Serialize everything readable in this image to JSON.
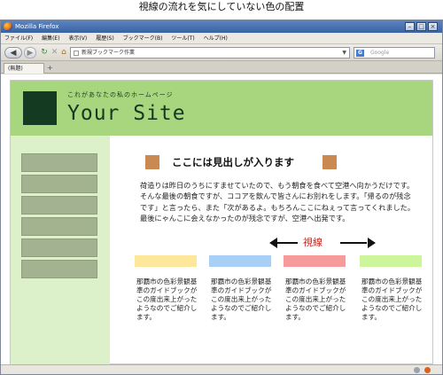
{
  "caption": "視線の流れを気にしていない色の配置",
  "browser": {
    "window_title": "Mozilla Firefox",
    "menu": [
      "ファイル(F)",
      "編集(E)",
      "表示(V)",
      "履歴(S)",
      "ブックマーク(B)",
      "ツール(T)",
      "ヘルプ(H)"
    ],
    "url": "新規ブックマーク作業",
    "search_placeholder": "Google",
    "tab_label": "(無題)",
    "new_tab": "+"
  },
  "site": {
    "tagline": "これがあなたの私のホームページ",
    "title": "Your Site",
    "heading": "ここには見出しが入ります",
    "paragraph": "荷造りは昨日のうちにすませていたので、もう朝食を食べて空港へ向かうだけです。そんな最後の朝食ですが、ココアを飲んで皆さんにお別れをします。「帰るのが残念です」と言ったら、また「次があるよ。もちろんここにねぇって言ってくれました。最後にゃんこに会えなかったのが残念ですが、空港へ出発です。",
    "arrow_label": "視線",
    "sidebar_count": 6,
    "columns": [
      {
        "color": "#fde79a",
        "text": "那覇市の色彩景観基準のガイドブックがこの度出来上がったようなのでご紹介します。"
      },
      {
        "color": "#a8d0f7",
        "text": "那覇市の色彩景観基準のガイドブックがこの度出来上がったようなのでご紹介します。"
      },
      {
        "color": "#f79a9a",
        "text": "那覇市の色彩景観基準のガイドブックがこの度出来上がったようなのでご紹介します。"
      },
      {
        "color": "#cdf59c",
        "text": "那覇市の色彩景観基準のガイドブックがこの度出来上がったようなのでご紹介します。"
      }
    ],
    "colors": {
      "header": "#a8d67e",
      "logo": "#153a22",
      "sidebar": "#dcf1c9",
      "sidebar_item": "#a3b391",
      "heading_square": "#c88a50",
      "arrow_label": "#c0271f"
    }
  }
}
